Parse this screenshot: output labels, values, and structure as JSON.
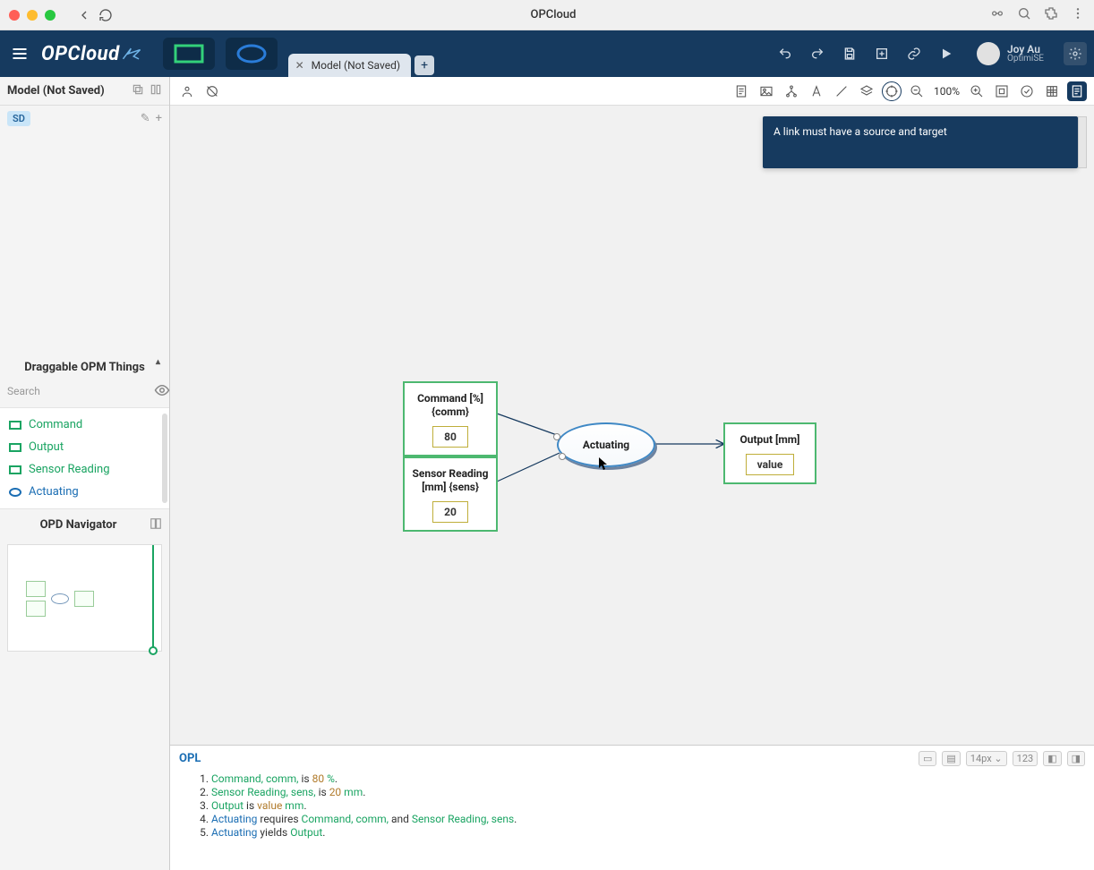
{
  "titlebar": {
    "title": "OPCloud"
  },
  "topbar": {
    "logo": "OPCloud",
    "tab_label": "Model (Not Saved)",
    "user_name": "Joy Au",
    "user_org": "OptimiSE"
  },
  "sidebar": {
    "model_title": "Model (Not Saved)",
    "sd_chip": "SD",
    "drag_header": "Draggable OPM Things",
    "search_placeholder": "Search",
    "things": [
      {
        "type": "obj",
        "label": "Command"
      },
      {
        "type": "obj",
        "label": "Output"
      },
      {
        "type": "obj",
        "label": "Sensor Reading"
      },
      {
        "type": "proc",
        "label": "Actuating"
      }
    ],
    "nav_header": "OPD Navigator"
  },
  "toolbar": {
    "zoom": "100%"
  },
  "notice": "A link must have a source and target",
  "diagram": {
    "command": {
      "title": "Command [%]\n{comm}",
      "value": "80"
    },
    "sensor": {
      "title": "Sensor Reading\n[mm] {sens}",
      "value": "20"
    },
    "output": {
      "title": "Output [mm]",
      "value": "value"
    },
    "process": {
      "label": "Actuating"
    }
  },
  "opl": {
    "header": "OPL",
    "font_size": "14px",
    "lines": [
      {
        "n": 1,
        "html": "<span class='c-obj'>Command, comm,</span> is <span class='c-val'>80</span> <span class='c-obj'>%</span>."
      },
      {
        "n": 2,
        "html": "<span class='c-obj'>Sensor Reading, sens,</span> is <span class='c-val'>20</span> <span class='c-obj'>mm</span>."
      },
      {
        "n": 3,
        "html": "<span class='c-obj'>Output</span> is <span class='c-val'>value</span> <span class='c-obj'>mm</span>."
      },
      {
        "n": 4,
        "html": "<span class='c-proc'>Actuating</span> requires <span class='c-obj'>Command, comm,</span> and <span class='c-obj'>Sensor Reading, sens</span>."
      },
      {
        "n": 5,
        "html": "<span class='c-proc'>Actuating</span> yields <span class='c-obj'>Output</span>."
      }
    ]
  }
}
